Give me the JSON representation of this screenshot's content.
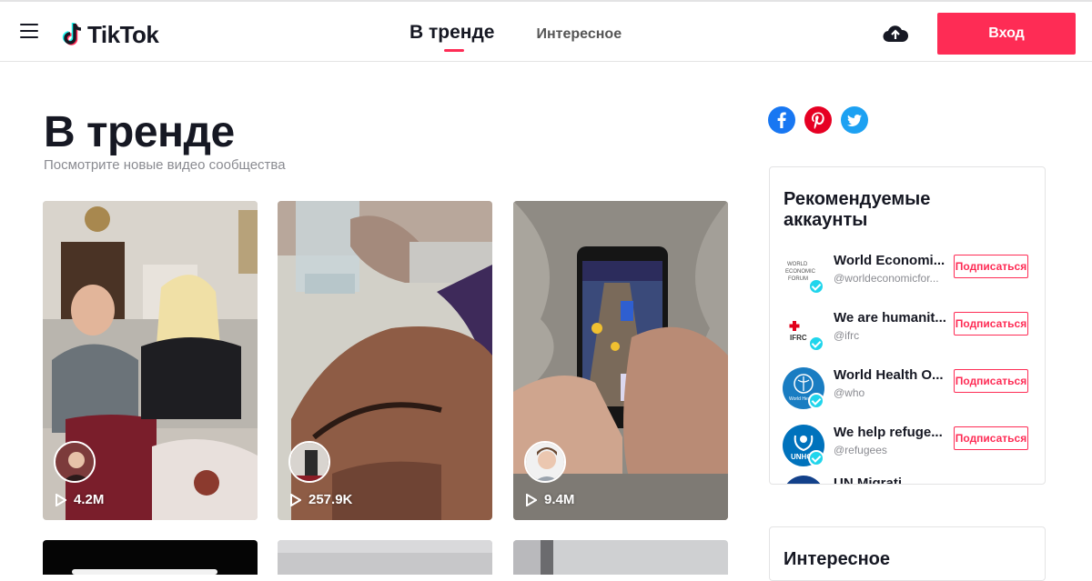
{
  "header": {
    "logo_text": "TikTok",
    "tabs": [
      {
        "label": "В тренде",
        "active": true
      },
      {
        "label": "Интересное",
        "active": false
      }
    ],
    "login_label": "Вход",
    "accent_color": "#fe2c55"
  },
  "main": {
    "title": "В тренде",
    "subtitle": "Посмотрите новые видео сообщества",
    "videos": [
      {
        "views": "4.2M"
      },
      {
        "views": "257.9K"
      },
      {
        "views": "9.4M"
      }
    ]
  },
  "sidebar": {
    "share_icons": [
      "facebook-icon",
      "pinterest-icon",
      "twitter-icon"
    ],
    "recommended": {
      "title": "Рекомендуемые аккаунты",
      "follow_label": "Подписаться",
      "accounts": [
        {
          "name": "World Economi...",
          "handle": "@worldeconomicfor..."
        },
        {
          "name": "We are humanit...",
          "handle": "@ifrc"
        },
        {
          "name": "World Health O...",
          "handle": "@who"
        },
        {
          "name": "We help refuge...",
          "handle": "@refugees"
        },
        {
          "name": "UN Migrati...",
          "handle": ""
        }
      ]
    },
    "discover": {
      "title": "Интересное"
    }
  }
}
